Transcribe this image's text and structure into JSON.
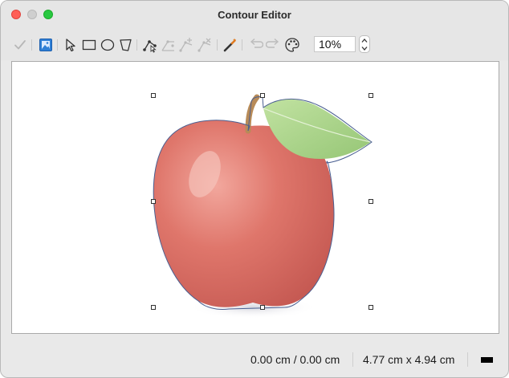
{
  "window": {
    "title": "Contour Editor"
  },
  "toolbar": {
    "tools": [
      {
        "id": "apply",
        "icon": "checkmark-icon",
        "enabled": false
      },
      {
        "id": "show-image",
        "icon": "image-icon",
        "enabled": true,
        "active": true
      },
      {
        "id": "select",
        "icon": "arrow-pointer-icon",
        "enabled": true
      },
      {
        "id": "rectangle",
        "icon": "rectangle-icon",
        "enabled": true
      },
      {
        "id": "ellipse",
        "icon": "ellipse-icon",
        "enabled": true
      },
      {
        "id": "polygon",
        "icon": "polygon-icon",
        "enabled": true
      },
      {
        "id": "edit-points",
        "icon": "edit-points-icon",
        "enabled": true
      },
      {
        "id": "move-points",
        "icon": "move-points-icon",
        "enabled": false
      },
      {
        "id": "insert-points",
        "icon": "insert-points-icon",
        "enabled": false
      },
      {
        "id": "delete-points",
        "icon": "delete-points-icon",
        "enabled": false
      },
      {
        "id": "auto-contour",
        "icon": "magic-wand-icon",
        "enabled": true
      },
      {
        "id": "undo",
        "icon": "undo-icon",
        "enabled": false
      },
      {
        "id": "redo",
        "icon": "redo-icon",
        "enabled": false
      },
      {
        "id": "palette",
        "icon": "palette-icon",
        "enabled": true
      }
    ],
    "zoom_value": "10%"
  },
  "status": {
    "position": "0.00 cm / 0.00 cm",
    "size": "4.77 cm x 4.94 cm",
    "line_color": "#000000"
  },
  "colors": {
    "contour_line": "#4a5f91",
    "apple_red": "#d96a62",
    "leaf_green": "#a4cf84",
    "accent_blue": "#2f7fd6"
  }
}
